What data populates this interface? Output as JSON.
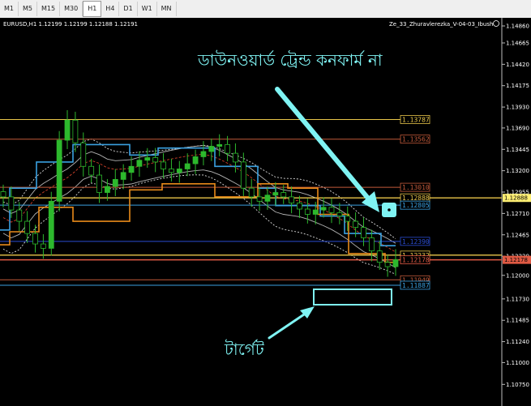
{
  "toolbar": {
    "timeframes": [
      "M1",
      "M5",
      "M15",
      "M30",
      "H1",
      "H4",
      "D1",
      "W1",
      "MN"
    ],
    "active": "H1"
  },
  "header": {
    "symbol_info": "EURUSD,H1  1.12199 1.12199 1.12188 1.12191",
    "indicator": "Ze_33_Zhuravlerezka_V-04-03_Ibush"
  },
  "annotations": {
    "top_text": "ডাউনওয়ার্ড ট্রেন্ড কনফার্ম না",
    "bottom_text": "টার্গেট"
  },
  "colors": {
    "background": "#000000",
    "candles": "#2db82d",
    "annotation": "#7ff3f3",
    "blue_line": "#3aa0e0",
    "orange_line": "#e88a1a",
    "gold_line": "#e8c54a"
  },
  "chart_data": {
    "type": "line",
    "ylim": [
      1.10595,
      1.1486
    ],
    "y_ticks": [
      "1.14860",
      "1.14665",
      "1.14420",
      "1.14175",
      "1.13930",
      "1.13690",
      "1.13445",
      "1.13200",
      "1.12955",
      "1.12710",
      "1.12465",
      "1.12220",
      "1.12000",
      "1.11730",
      "1.11485",
      "1.11240",
      "1.11000",
      "1.10750"
    ],
    "price_markers": [
      {
        "label": "1.12888",
        "value": 1.12888,
        "color": "#ffef73"
      },
      {
        "label": "1.12178",
        "value": 1.12178,
        "color": "#e05a44"
      }
    ],
    "levels": [
      {
        "label": "1.13787",
        "value": 1.13787,
        "color": "#e8c54a"
      },
      {
        "label": "1.13562",
        "value": 1.13562,
        "color": "#c25a3a"
      },
      {
        "label": "1.13010",
        "value": 1.1301,
        "color": "#c25a3a"
      },
      {
        "label": "1.12888",
        "value": 1.12888,
        "color": "#e8c54a"
      },
      {
        "label": "1.12805",
        "value": 1.12805,
        "color": "#3aa0e0"
      },
      {
        "label": "1.12390",
        "value": 1.1239,
        "color": "#2a4cd0"
      },
      {
        "label": "1.12232",
        "value": 1.12232,
        "color": "#e8c54a"
      },
      {
        "label": "1.12178",
        "value": 1.12178,
        "color": "#e05a44"
      },
      {
        "label": "1.11949",
        "value": 1.11949,
        "color": "#c25a3a"
      },
      {
        "label": "1.11887",
        "value": 1.11887,
        "color": "#3aa0e0"
      }
    ],
    "close": [
      1.129,
      1.1275,
      1.1262,
      1.1248,
      1.1236,
      1.1231,
      1.1285,
      1.1355,
      1.1378,
      1.1352,
      1.1325,
      1.1315,
      1.1295,
      1.1302,
      1.131,
      1.1318,
      1.1325,
      1.1332,
      1.1335,
      1.133,
      1.1322,
      1.1318,
      1.1322,
      1.1328,
      1.1336,
      1.1342,
      1.1348,
      1.135,
      1.134,
      1.133,
      1.13,
      1.129,
      1.1285,
      1.1292,
      1.1295,
      1.129,
      1.1283,
      1.1276,
      1.127,
      1.1275,
      1.1278,
      1.1272,
      1.1268,
      1.1262,
      1.1255,
      1.1243,
      1.1228,
      1.1215,
      1.121,
      1.1218
    ]
  }
}
